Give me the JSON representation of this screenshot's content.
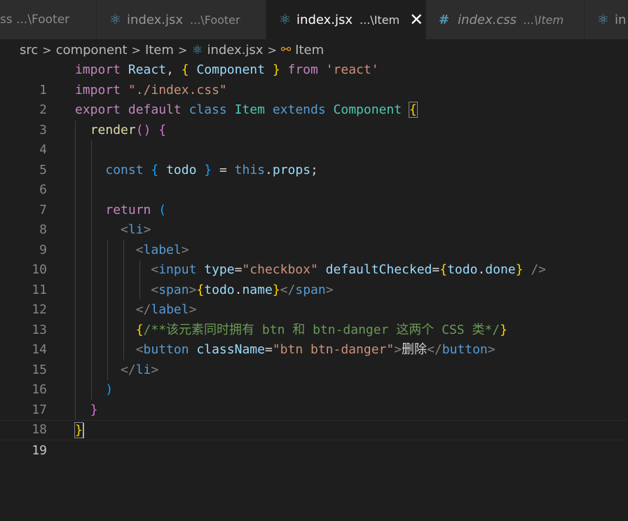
{
  "tabs": [
    {
      "icon": "react-icon",
      "name": "",
      "path": "ss ...\\Footer",
      "active": false
    },
    {
      "icon": "react-icon",
      "name": "index.jsx",
      "path": "...\\Footer",
      "active": false
    },
    {
      "icon": "react-icon",
      "name": "index.jsx",
      "path": "...\\Item",
      "active": true,
      "close": "✕"
    },
    {
      "icon": "hash-icon",
      "name": "index.css",
      "path": "...\\Item",
      "active": false
    },
    {
      "icon": "react-icon",
      "name": "in",
      "path": "",
      "active": false
    }
  ],
  "breadcrumb": {
    "items": [
      "src",
      "component",
      "Item",
      "index.jsx",
      "Item"
    ]
  },
  "editor": {
    "current_line": 19,
    "line_numbers": [
      "1",
      "2",
      "3",
      "4",
      "5",
      "6",
      "7",
      "8",
      "9",
      "10",
      "11",
      "12",
      "13",
      "14",
      "15",
      "16",
      "17",
      "18",
      "19"
    ]
  },
  "code": {
    "l1": [
      "import",
      "React",
      ", ",
      "{",
      " Component ",
      "}",
      " from ",
      "'react'"
    ],
    "l2": [
      "import",
      "\"./index.css\""
    ],
    "l3": [
      "export",
      "default",
      "class",
      "Item",
      "extends",
      "Component",
      "{"
    ],
    "l4": [
      "render",
      "(",
      ")",
      "{"
    ],
    "l6": [
      "const",
      "{",
      "todo",
      "}",
      "=",
      "this",
      ".",
      "props",
      ";"
    ],
    "l8": [
      "return",
      "("
    ],
    "l9": [
      "<",
      "li",
      ">"
    ],
    "l10": [
      "<",
      "label",
      ">"
    ],
    "l11": [
      "<",
      "input",
      "type",
      "=",
      "\"checkbox\"",
      "defaultChecked",
      "=",
      "{",
      "todo",
      ".",
      "done",
      "}",
      "/>"
    ],
    "l12": [
      "<",
      "span",
      ">",
      "{",
      "todo",
      ".",
      "name",
      "}",
      "</",
      "span",
      ">"
    ],
    "l13": [
      "</",
      "label",
      ">"
    ],
    "l14": [
      "{",
      "/**该元素同时拥有 btn 和 btn-danger 这两个 CSS 类*/",
      "}"
    ],
    "l15": [
      "<",
      "button",
      "className",
      "=",
      "\"btn btn-danger\"",
      ">",
      "删除",
      "</",
      "button",
      ">"
    ],
    "l16": [
      "</",
      "li",
      ">"
    ],
    "l17": [
      ")"
    ],
    "l18": [
      "}"
    ],
    "l19": [
      "}"
    ]
  }
}
